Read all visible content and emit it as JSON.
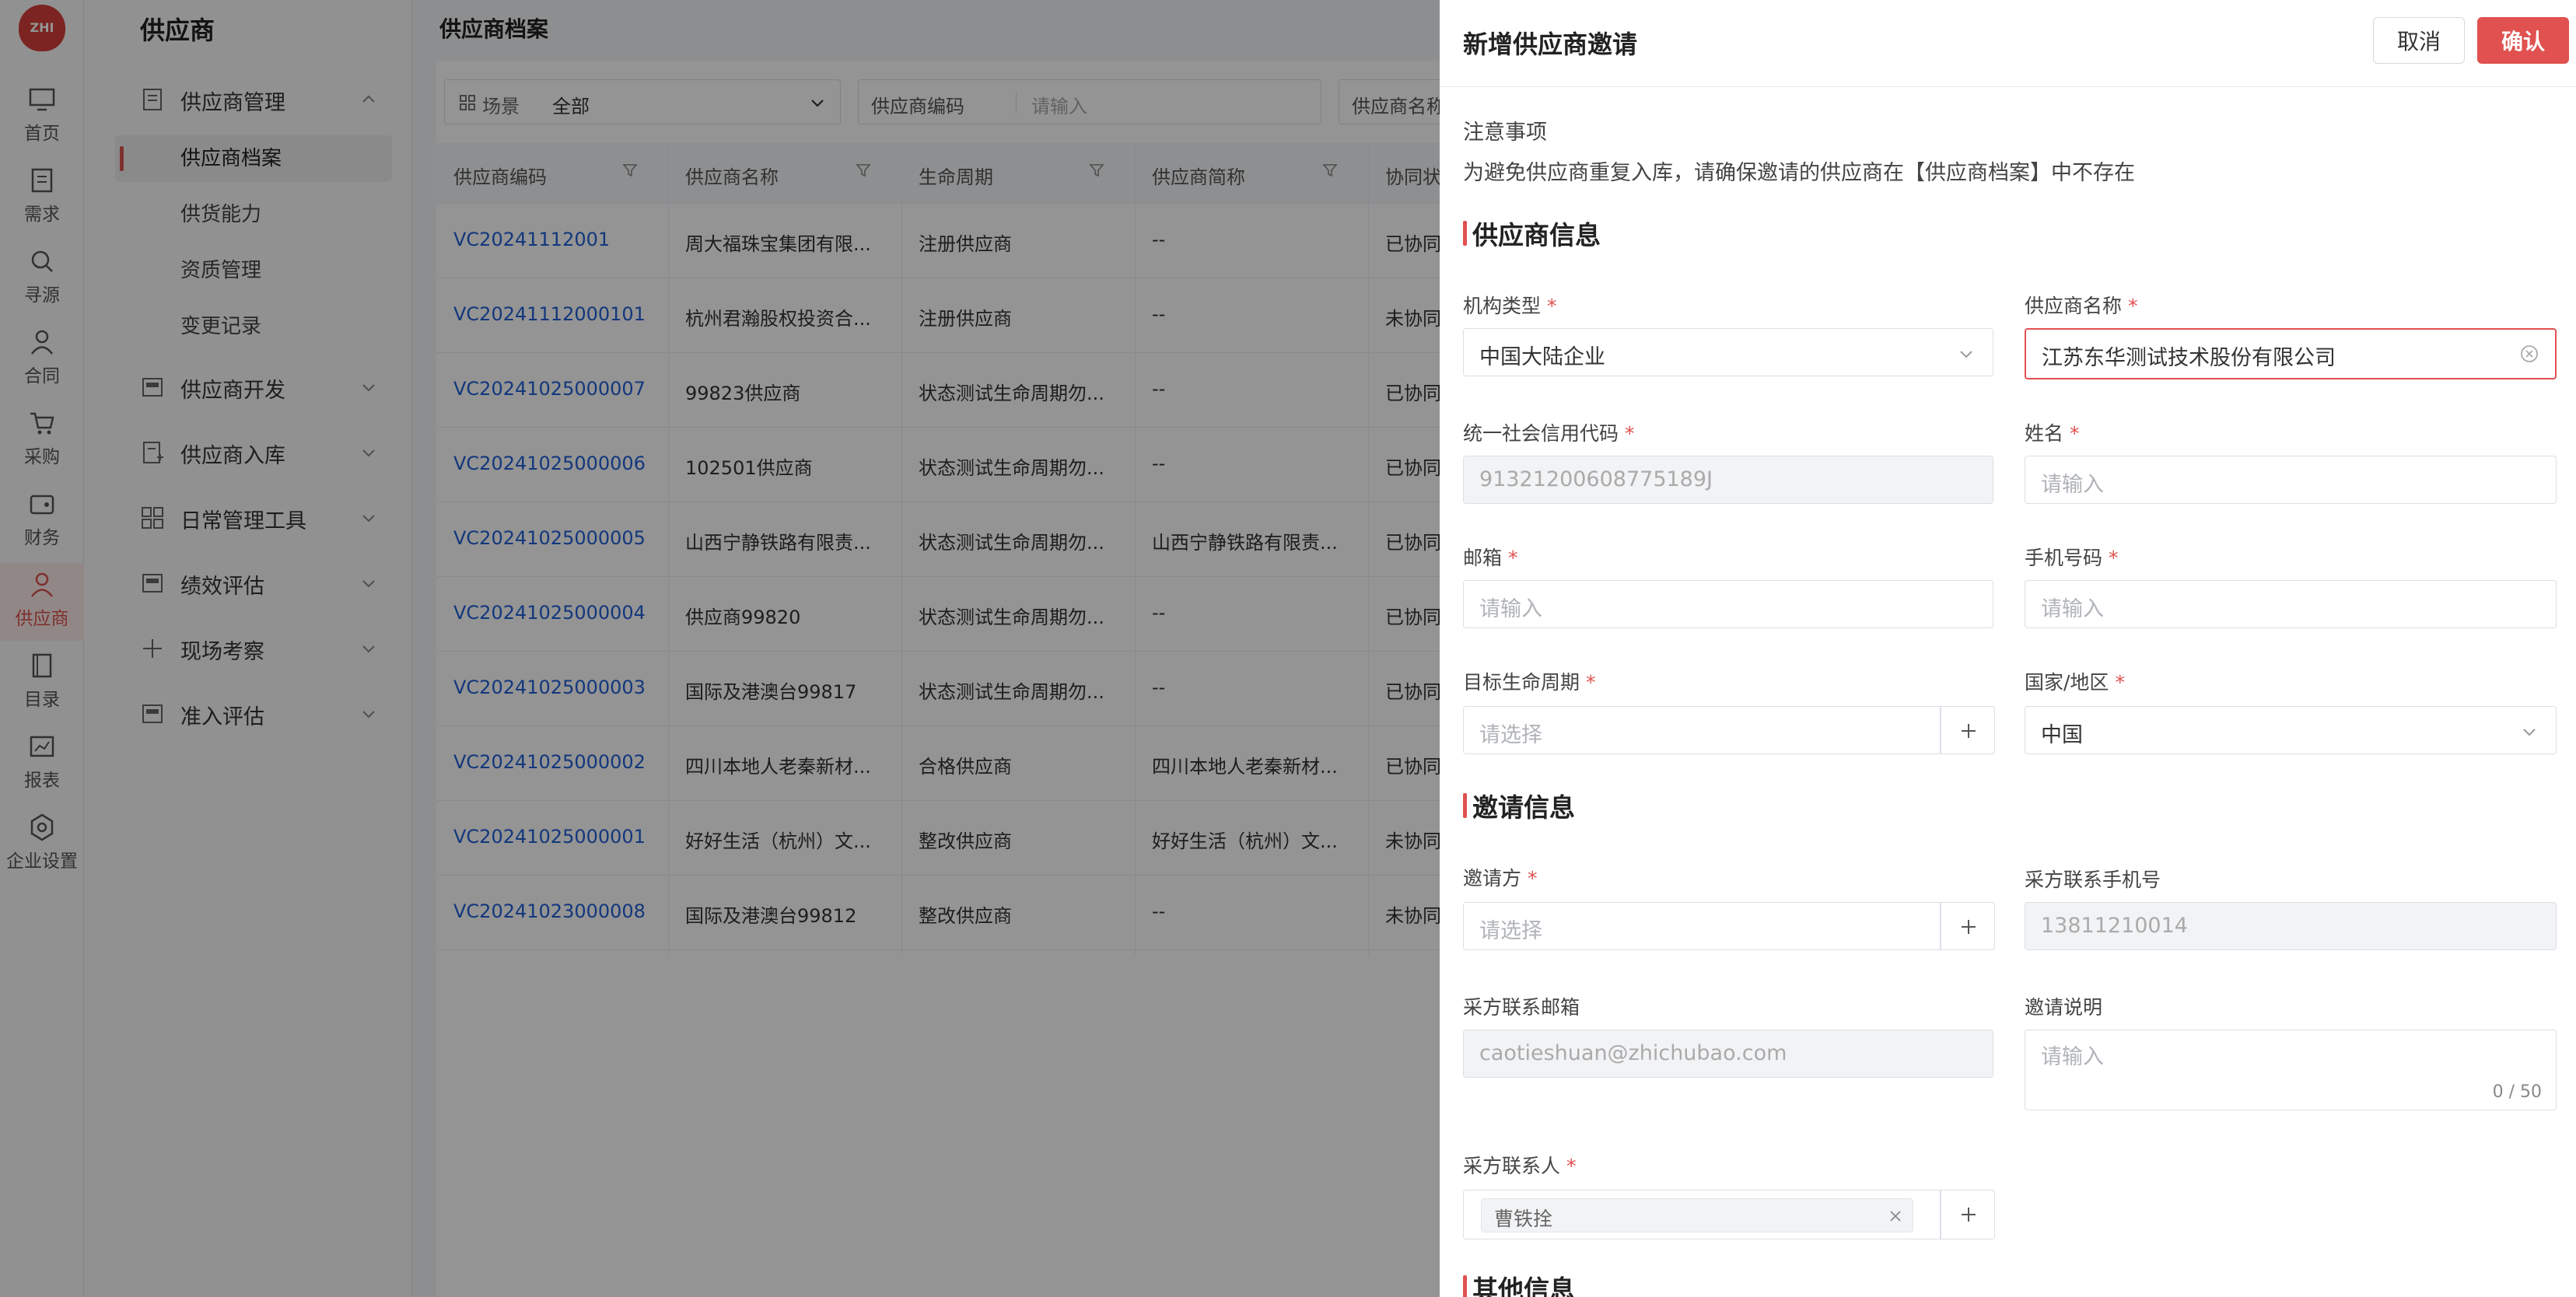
{
  "rail": {
    "logo": "ZHI",
    "items": [
      {
        "label": "首页",
        "icon": "monitor-icon"
      },
      {
        "label": "需求",
        "icon": "clipboard-icon"
      },
      {
        "label": "寻源",
        "icon": "search-icon"
      },
      {
        "label": "合同",
        "icon": "person-icon"
      },
      {
        "label": "采购",
        "icon": "cart-icon"
      },
      {
        "label": "财务",
        "icon": "wallet-icon"
      },
      {
        "label": "供应商",
        "icon": "supplier-icon"
      },
      {
        "label": "目录",
        "icon": "book-icon"
      },
      {
        "label": "报表",
        "icon": "chart-icon"
      },
      {
        "label": "企业设置",
        "icon": "gear-icon"
      }
    ],
    "active": "供应商"
  },
  "sidebar": {
    "title": "供应商",
    "groups": [
      {
        "label": "供应商管理",
        "expanded": true,
        "children": [
          "供应商档案",
          "供货能力",
          "资质管理",
          "变更记录"
        ]
      },
      {
        "label": "供应商开发"
      },
      {
        "label": "供应商入库"
      },
      {
        "label": "日常管理工具"
      },
      {
        "label": "绩效评估"
      },
      {
        "label": "现场考察"
      },
      {
        "label": "准入评估"
      }
    ],
    "active_child": "供应商档案"
  },
  "main": {
    "title": "供应商档案",
    "filters": {
      "scene_label": "场景",
      "scene_value": "全部",
      "code_label": "供应商编码",
      "code_placeholder": "请输入",
      "name_label": "供应商名称"
    },
    "table": {
      "columns": [
        "供应商编码",
        "供应商名称",
        "生命周期",
        "供应商简称",
        "协同状"
      ],
      "rows": [
        [
          "VC20241112001",
          "周大福珠宝集团有限...",
          "注册供应商",
          "--",
          "已协同"
        ],
        [
          "VC20241112000101",
          "杭州君瀚股权投资合...",
          "注册供应商",
          "--",
          "未协同"
        ],
        [
          "VC20241025000007",
          "99823供应商",
          "状态测试生命周期勿...",
          "--",
          "已协同"
        ],
        [
          "VC20241025000006",
          "102501供应商",
          "状态测试生命周期勿...",
          "--",
          "已协同"
        ],
        [
          "VC20241025000005",
          "山西宁静铁路有限责...",
          "状态测试生命周期勿...",
          "山西宁静铁路有限责...",
          "已协同"
        ],
        [
          "VC20241025000004",
          "供应商99820",
          "状态测试生命周期勿...",
          "--",
          "已协同"
        ],
        [
          "VC20241025000003",
          "国际及港澳台99817",
          "状态测试生命周期勿...",
          "--",
          "已协同"
        ],
        [
          "VC20241025000002",
          "四川本地人老秦新材...",
          "合格供应商",
          "四川本地人老秦新材...",
          "已协同"
        ],
        [
          "VC20241025000001",
          "好好生活（杭州）文...",
          "整改供应商",
          "好好生活（杭州）文...",
          "未协同"
        ],
        [
          "VC20241023000008",
          "国际及港澳台99812",
          "整改供应商",
          "--",
          "未协同"
        ]
      ]
    }
  },
  "drawer": {
    "title": "新增供应商邀请",
    "cancel": "取消",
    "confirm": "确认",
    "notice_title": "注意事项",
    "notice_text": "为避免供应商重复入库，请确保邀请的供应商在【供应商档案】中不存在",
    "section_supplier": "供应商信息",
    "section_invite": "邀请信息",
    "section_other": "其他信息",
    "fields": {
      "org_type": {
        "label": "机构类型",
        "value": "中国大陆企业"
      },
      "supplier_name": {
        "label": "供应商名称",
        "value": "江苏东华测试技术股份有限公司"
      },
      "credit_code": {
        "label": "统一社会信用代码",
        "value": "91321200608775189J"
      },
      "name": {
        "label": "姓名",
        "placeholder": "请输入"
      },
      "email": {
        "label": "邮箱",
        "placeholder": "请输入"
      },
      "phone": {
        "label": "手机号码",
        "placeholder": "请输入"
      },
      "lifecycle": {
        "label": "目标生命周期",
        "placeholder": "请选择"
      },
      "country": {
        "label": "国家/地区",
        "value": "中国"
      },
      "inviter": {
        "label": "邀请方",
        "placeholder": "请选择"
      },
      "buyer_phone": {
        "label": "采方联系手机号",
        "value": "13811210014"
      },
      "buyer_email": {
        "label": "采方联系邮箱",
        "value": "caotieshuan@zhichubao.com"
      },
      "invite_note": {
        "label": "邀请说明",
        "placeholder": "请输入",
        "count": "0 / 50"
      },
      "buyer_contact": {
        "label": "采方联系人",
        "tag": "曹铁拴"
      }
    }
  },
  "colors": {
    "accent": "#e0514f",
    "link": "#1f5fd6"
  }
}
